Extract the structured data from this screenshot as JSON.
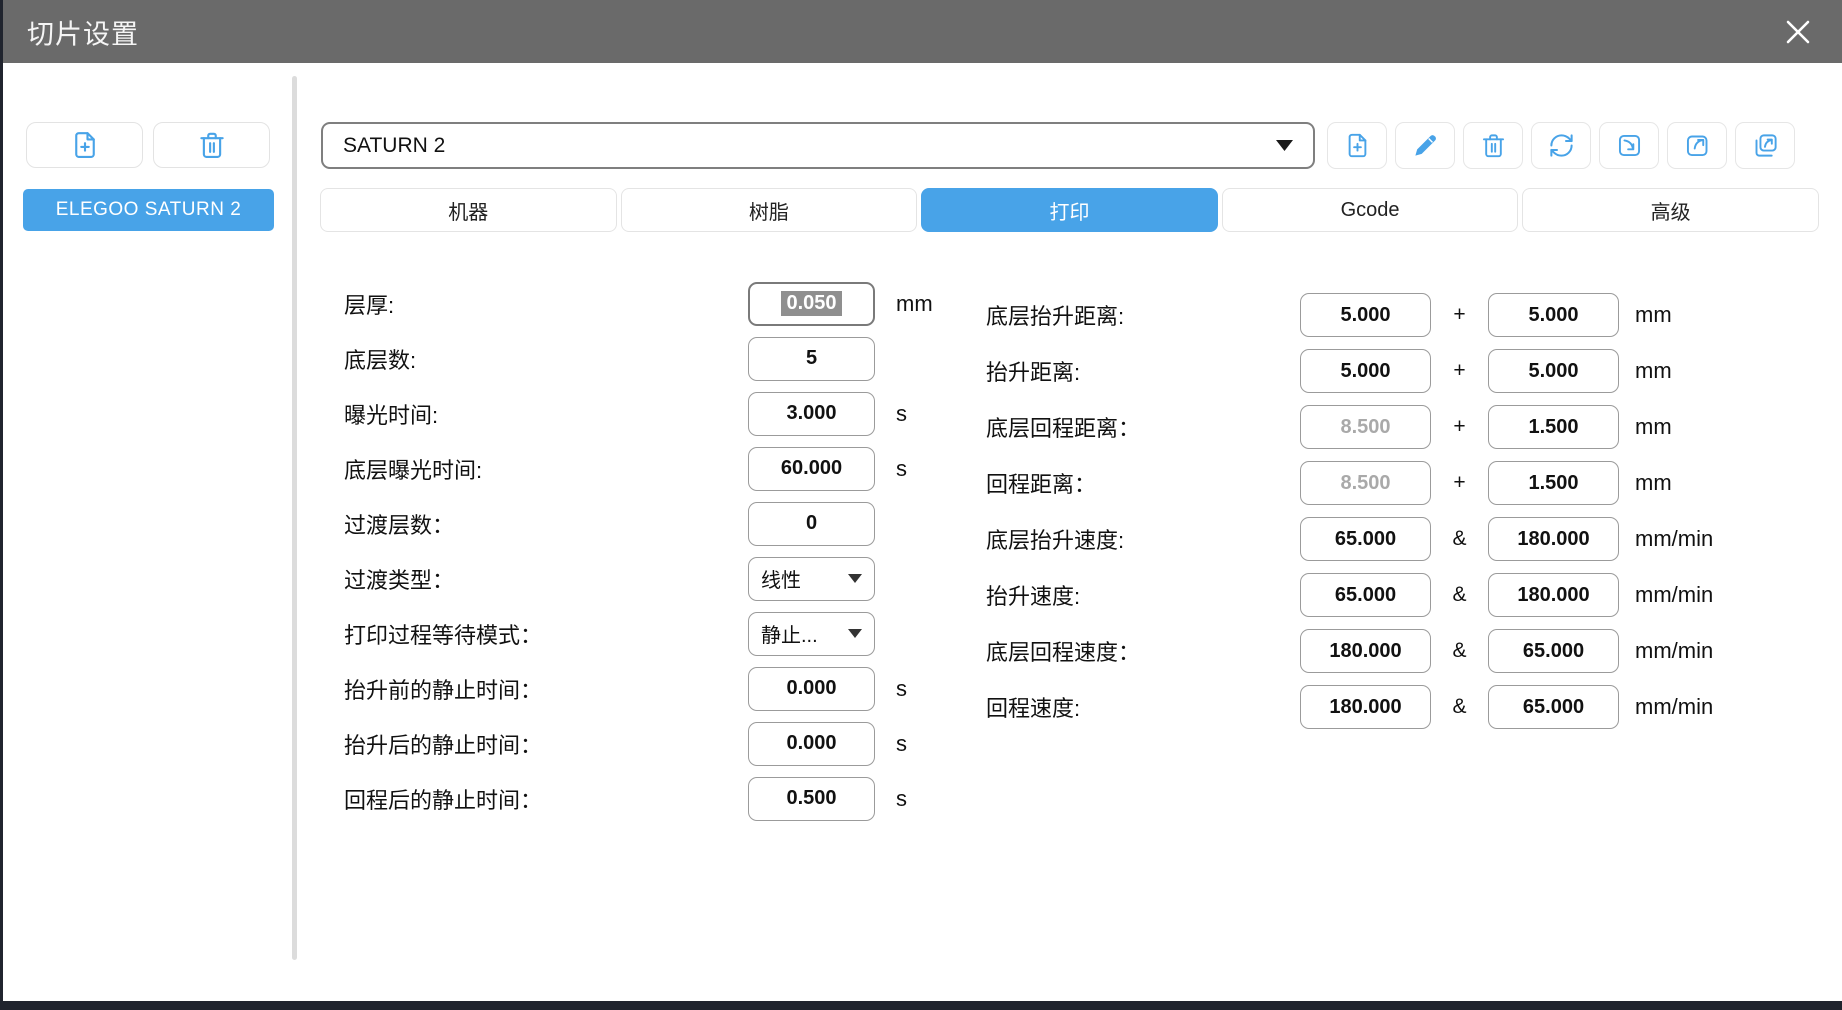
{
  "titlebar": {
    "title": "切片设置"
  },
  "sidebar": {
    "profile_button": "ELEGOO SATURN 2"
  },
  "toolbar": {
    "machine_select_value": "SATURN 2",
    "buttons": [
      "file-plus-icon",
      "pencil-icon",
      "trash-icon",
      "refresh-icon",
      "import-icon",
      "export-icon",
      "export-all-icon"
    ]
  },
  "tabs": [
    {
      "label": "机器",
      "active": false
    },
    {
      "label": "树脂",
      "active": false
    },
    {
      "label": "打印",
      "active": true
    },
    {
      "label": "Gcode",
      "active": false
    },
    {
      "label": "高级",
      "active": false
    }
  ],
  "form": {
    "left": [
      {
        "label": "层厚:",
        "value": "0.050",
        "unit": "mm",
        "selected": true
      },
      {
        "label": "底层数:",
        "value": "5",
        "unit": ""
      },
      {
        "label": "曝光时间:",
        "value": "3.000",
        "unit": "s"
      },
      {
        "label": "底层曝光时间:",
        "value": "60.000",
        "unit": "s"
      },
      {
        "label": "过渡层数：",
        "value": "0",
        "unit": ""
      },
      {
        "label": "过渡类型：",
        "value": "线性",
        "unit": "",
        "type": "select"
      },
      {
        "label": "打印过程等待模式：",
        "value": "静止...",
        "unit": "",
        "type": "select"
      },
      {
        "label": "抬升前的静止时间：",
        "value": "0.000",
        "unit": "s"
      },
      {
        "label": "抬升后的静止时间：",
        "value": "0.000",
        "unit": "s"
      },
      {
        "label": "回程后的静止时间：",
        "value": "0.500",
        "unit": "s"
      }
    ],
    "right": [
      {
        "label": "底层抬升距离:",
        "value1": "5.000",
        "sep": "+",
        "value2": "5.000",
        "unit": "mm",
        "value1_disabled": false
      },
      {
        "label": "抬升距离:",
        "value1": "5.000",
        "sep": "+",
        "value2": "5.000",
        "unit": "mm",
        "value1_disabled": false
      },
      {
        "label": "底层回程距离：",
        "value1": "8.500",
        "sep": "+",
        "value2": "1.500",
        "unit": "mm",
        "value1_disabled": true
      },
      {
        "label": "回程距离：",
        "value1": "8.500",
        "sep": "+",
        "value2": "1.500",
        "unit": "mm",
        "value1_disabled": true
      },
      {
        "label": "底层抬升速度:",
        "value1": "65.000",
        "sep": "&",
        "value2": "180.000",
        "unit": "mm/min",
        "value1_disabled": false
      },
      {
        "label": "抬升速度:",
        "value1": "65.000",
        "sep": "&",
        "value2": "180.000",
        "unit": "mm/min",
        "value1_disabled": false
      },
      {
        "label": "底层回程速度：",
        "value1": "180.000",
        "sep": "&",
        "value2": "65.000",
        "unit": "mm/min",
        "value1_disabled": false
      },
      {
        "label": "回程速度:",
        "value1": "180.000",
        "sep": "&",
        "value2": "65.000",
        "unit": "mm/min",
        "value1_disabled": false
      }
    ]
  },
  "colors": {
    "accent_blue": "#48a3e8",
    "titlebar_gray": "#6a6a6a",
    "disabled_text": "#a9a9a9",
    "selection_bg": "#8f8f8f",
    "frame_dark": "#20242e"
  }
}
